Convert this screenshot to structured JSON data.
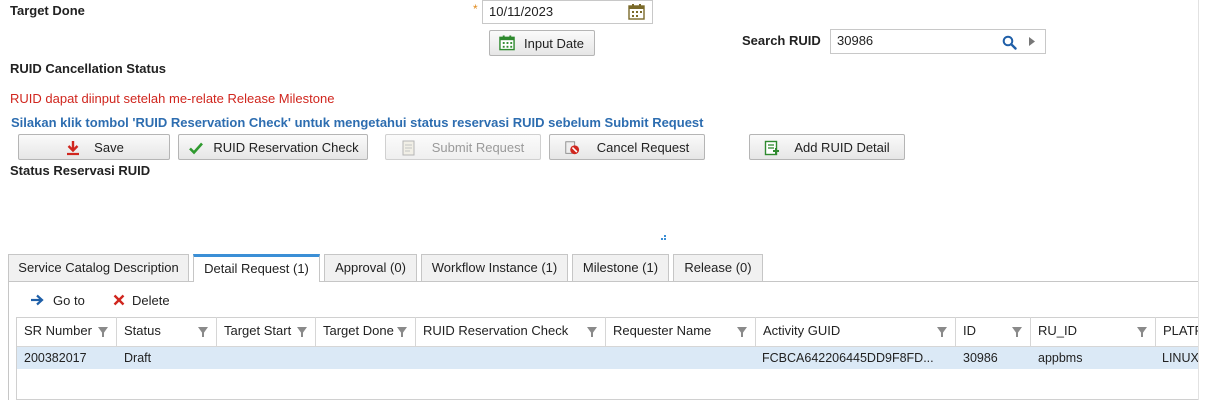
{
  "form": {
    "target_done_label": "Target Done",
    "required_mark": "*",
    "target_done_value": "10/11/2023",
    "input_date_label": "Input Date",
    "search_label": "Search RUID",
    "search_value": "30986",
    "cancellation_status_label": "RUID Cancellation Status",
    "warning_text": "RUID dapat diinput setelah me-relate Release Milestone",
    "info_text": "Silakan klik tombol 'RUID Reservation Check' untuk mengetahui status reservasi RUID sebelum Submit Request",
    "reservation_status_label": "Status Reservasi RUID"
  },
  "toolbar": {
    "save": "Save",
    "reservation_check": "RUID Reservation Check",
    "submit": "Submit Request",
    "cancel": "Cancel Request",
    "add_detail": "Add RUID Detail"
  },
  "tabs": [
    {
      "label": "Service Catalog Description"
    },
    {
      "label": "Detail Request (1)"
    },
    {
      "label": "Approval (0)"
    },
    {
      "label": "Workflow Instance (1)"
    },
    {
      "label": "Milestone (1)"
    },
    {
      "label": "Release (0)"
    }
  ],
  "grid_toolbar": {
    "goto": "Go to",
    "delete": "Delete"
  },
  "table": {
    "columns": [
      "SR Number",
      "Status",
      "Target Start",
      "Target Done",
      "RUID Reservation Check",
      "Requester Name",
      "Activity GUID",
      "ID",
      "RU_ID",
      "PLATF"
    ],
    "rows": [
      [
        "200382017",
        "Draft",
        "",
        "",
        "",
        "",
        "FCBCA642206445DD9F8FD...",
        "30986",
        "appbms",
        "LINUX"
      ]
    ]
  },
  "colors": {
    "warning": "#d0261e",
    "info": "#2d6db0",
    "tab_accent": "#3b8fd6",
    "selected_row": "#dbe9f6"
  }
}
